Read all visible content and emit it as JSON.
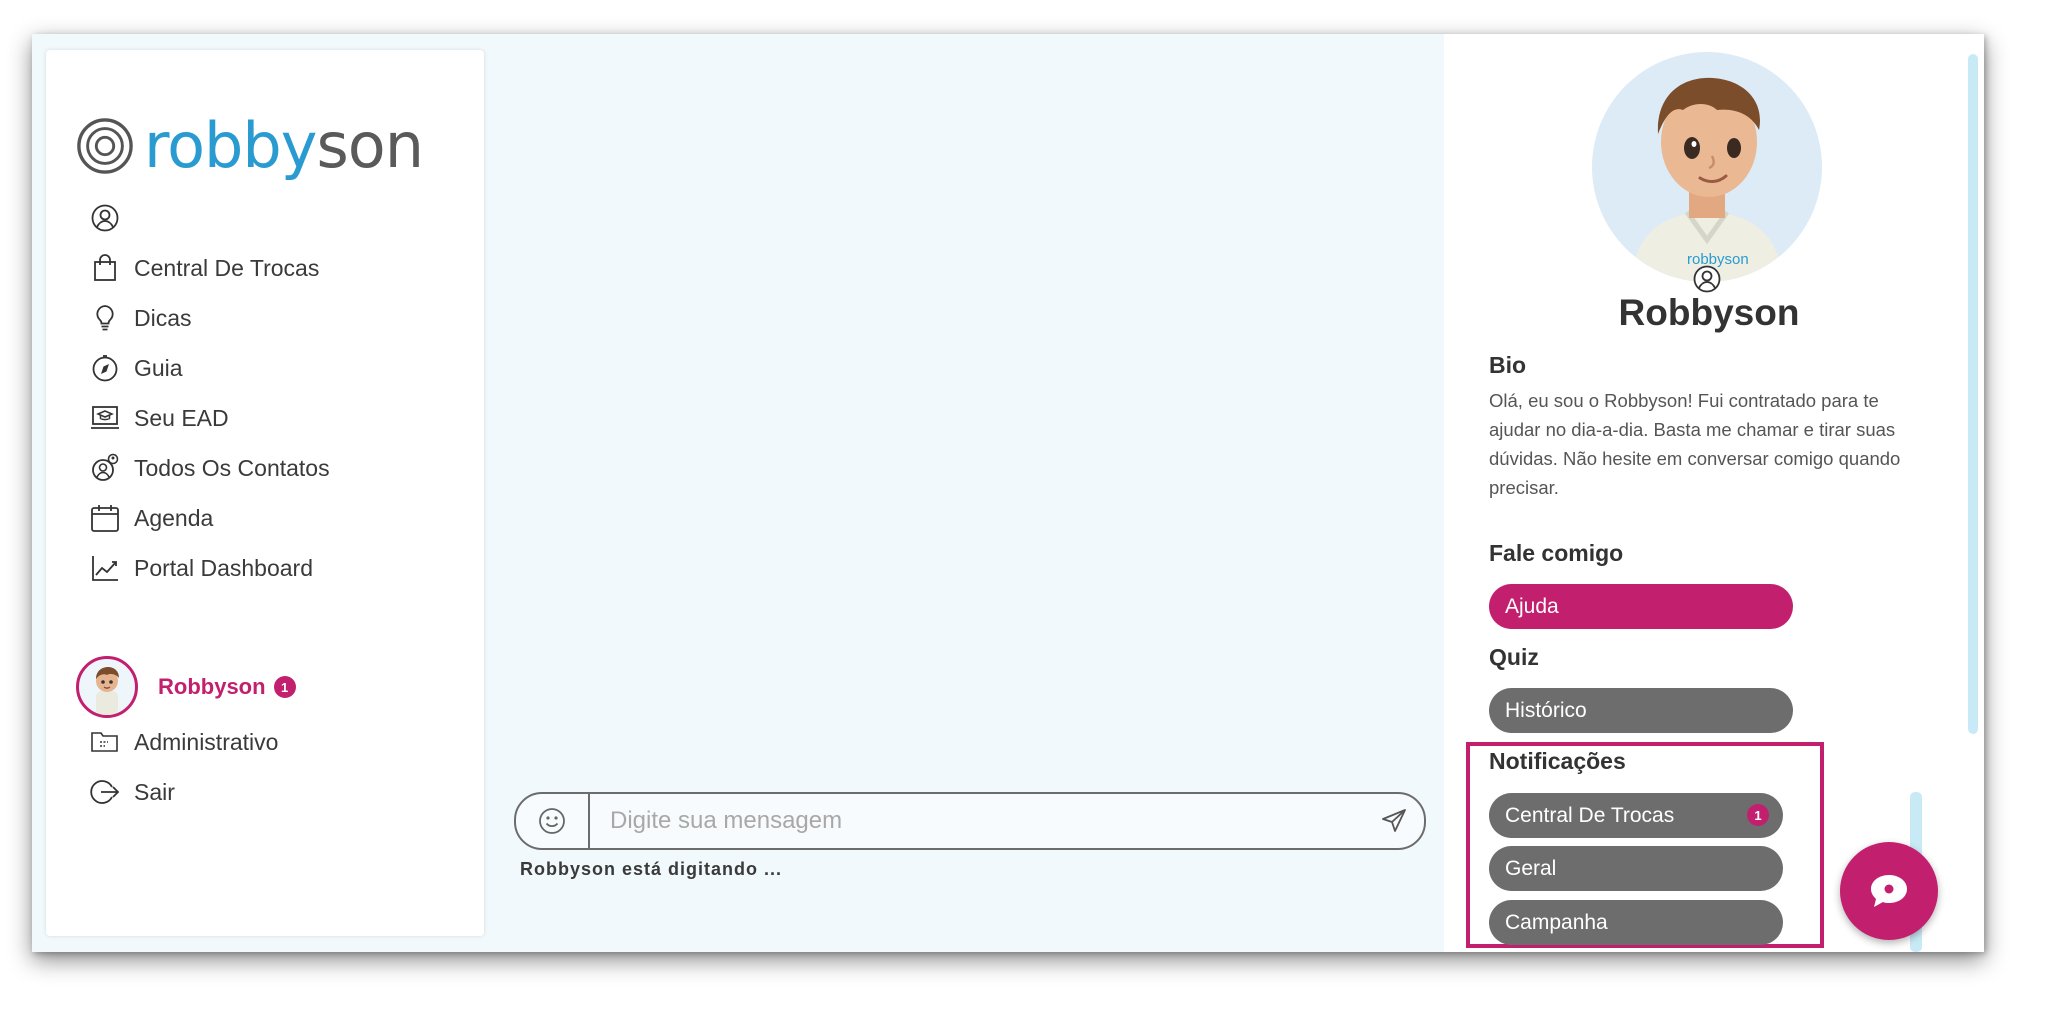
{
  "logo": {
    "part1": "robby",
    "part2": "son"
  },
  "nav": {
    "items": [
      {
        "label": "",
        "icon": "user-circle-icon"
      },
      {
        "label": "Central De Trocas",
        "icon": "shopping-bag-icon"
      },
      {
        "label": "Dicas",
        "icon": "lightbulb-icon"
      },
      {
        "label": "Guia",
        "icon": "compass-icon"
      },
      {
        "label": "Seu EAD",
        "icon": "graduation-laptop-icon"
      },
      {
        "label": "Todos Os Contatos",
        "icon": "contacts-icon"
      },
      {
        "label": "Agenda",
        "icon": "calendar-icon"
      },
      {
        "label": "Portal Dashboard",
        "icon": "chart-line-icon"
      }
    ],
    "bot": {
      "name": "Robbyson",
      "badge": "1"
    },
    "admin": "Administrativo",
    "logout": "Sair"
  },
  "chat": {
    "placeholder": "Digite sua mensagem",
    "typing_name": "Robbyson",
    "typing_text": "está digitando ..."
  },
  "profile": {
    "name": "Robbyson",
    "bio_title": "Bio",
    "bio": "Olá, eu sou o Robbyson! Fui contratado para te ajudar no dia-a-dia. Basta me chamar e tirar suas dúvidas. Não hesite em conversar comigo quando precisar.",
    "fale_title": "Fale comigo",
    "ajuda": "Ajuda",
    "quiz_title": "Quiz",
    "historico": "Histórico",
    "notif_title": "Notificações",
    "notif": [
      {
        "label": "Central De Trocas",
        "badge": "1"
      },
      {
        "label": "Geral"
      },
      {
        "label": "Campanha"
      }
    ]
  },
  "colors": {
    "accent": "#c2206e",
    "brand_blue": "#2a9bd0",
    "pill_gray": "#6d6d6d",
    "chat_bg": "#f1f9fc"
  }
}
